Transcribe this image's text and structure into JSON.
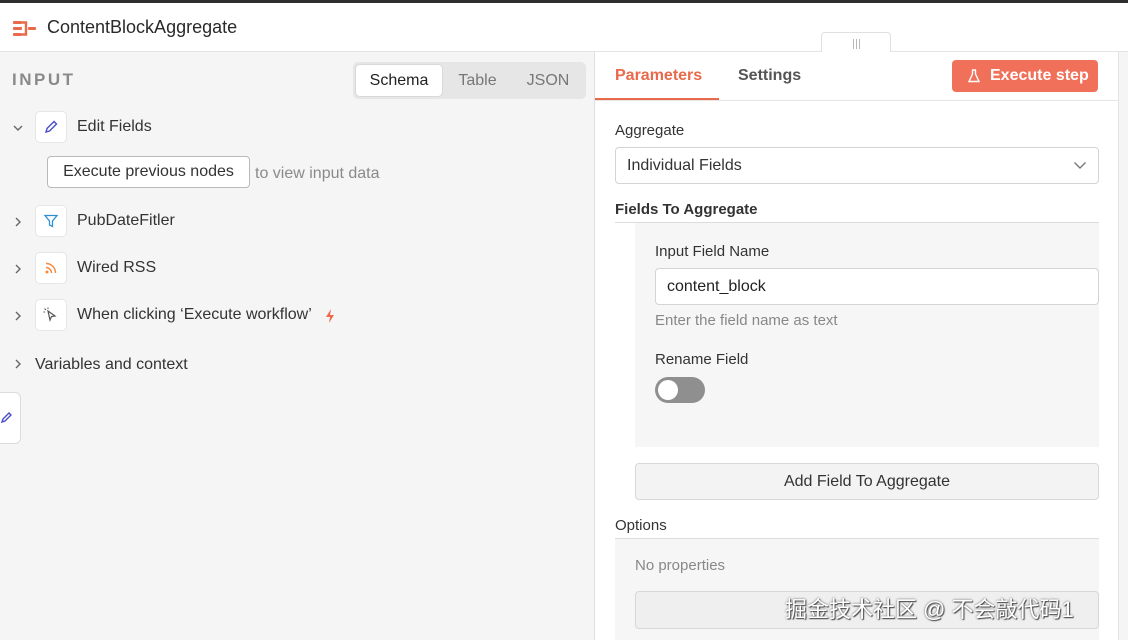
{
  "header": {
    "title": "ContentBlockAggregate",
    "icon": "aggregate-node-icon",
    "accent": "#e9694b"
  },
  "input_panel": {
    "title": "INPUT",
    "view_tabs": [
      {
        "label": "Schema",
        "active": true
      },
      {
        "label": "Table",
        "active": false
      },
      {
        "label": "JSON",
        "active": false
      }
    ],
    "nodes": [
      {
        "label": "Edit Fields",
        "icon": "pencil-icon",
        "expanded": true
      },
      {
        "label": "PubDateFitler",
        "icon": "filter-icon",
        "expanded": false
      },
      {
        "label": "Wired RSS",
        "icon": "rss-icon",
        "expanded": false
      },
      {
        "label": "When clicking ‘Execute workflow’",
        "icon": "cursor-click-icon",
        "expanded": false,
        "trigger": true
      }
    ],
    "execute_previous_label": "Execute previous nodes",
    "view_input_text": "to view input data",
    "variables_label": "Variables and context"
  },
  "params_panel": {
    "tabs": [
      {
        "label": "Parameters",
        "active": true
      },
      {
        "label": "Settings",
        "active": false
      }
    ],
    "execute_step_label": "Execute step",
    "execute_step_color": "#f0705a",
    "aggregate_label": "Aggregate",
    "aggregate_value": "Individual Fields",
    "fields_section": "Fields To Aggregate",
    "input_field_label": "Input Field Name",
    "input_field_value": "content_block",
    "input_field_hint": "Enter the field name as text",
    "rename_label": "Rename Field",
    "rename_enabled": false,
    "add_field_label": "Add Field To Aggregate",
    "options_section": "Options",
    "no_properties": "No properties"
  },
  "watermark": "掘金技术社区 @ 不会敲代码1"
}
